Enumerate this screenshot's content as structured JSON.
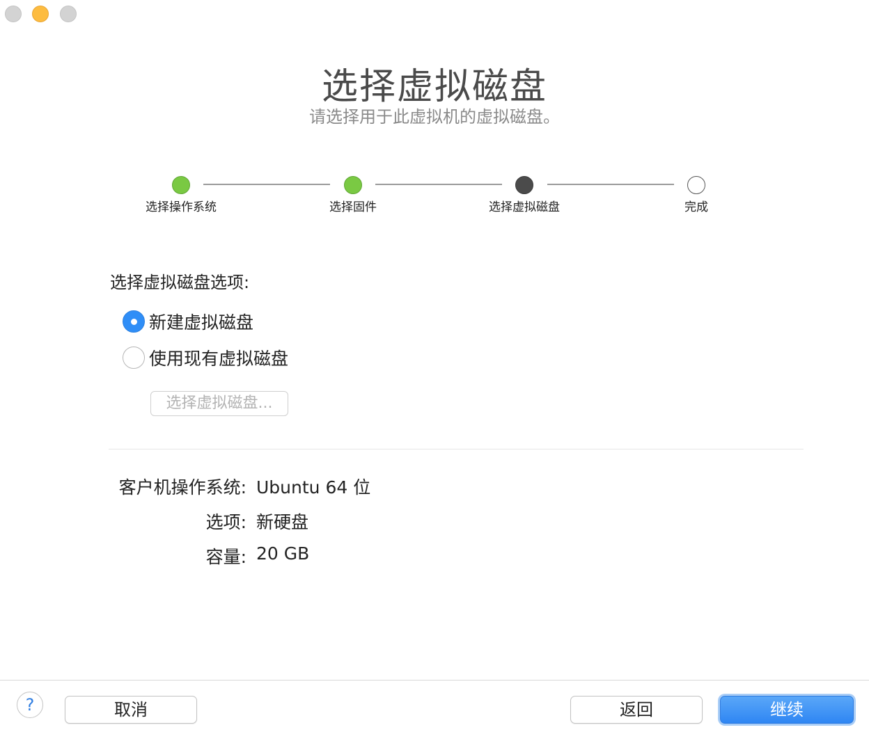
{
  "window": {
    "title": "选择虚拟磁盘",
    "subtitle": "请选择用于此虚拟机的虚拟磁盘。"
  },
  "steps": [
    {
      "label": "选择操作系统",
      "state": "done"
    },
    {
      "label": "选择固件",
      "state": "done"
    },
    {
      "label": "选择虚拟磁盘",
      "state": "current"
    },
    {
      "label": "完成",
      "state": "pending"
    }
  ],
  "options": {
    "heading": "选择虚拟磁盘选项:",
    "new_disk_label": "新建虚拟磁盘",
    "new_disk_selected": true,
    "existing_disk_label": "使用现有虚拟磁盘",
    "existing_disk_selected": false,
    "choose_button_label": "选择虚拟磁盘..."
  },
  "summary": {
    "guest_os_key": "客户机操作系统:",
    "guest_os_value": "Ubuntu 64 位",
    "option_key": "选项:",
    "option_value": "新硬盘",
    "capacity_key": "容量:",
    "capacity_value": "20 GB"
  },
  "footer": {
    "help_label": "?",
    "cancel_label": "取消",
    "back_label": "返回",
    "continue_label": "继续"
  },
  "colors": {
    "step_done": "#7ac943",
    "step_current": "#4b4b4b",
    "accent": "#2f8ef7"
  }
}
